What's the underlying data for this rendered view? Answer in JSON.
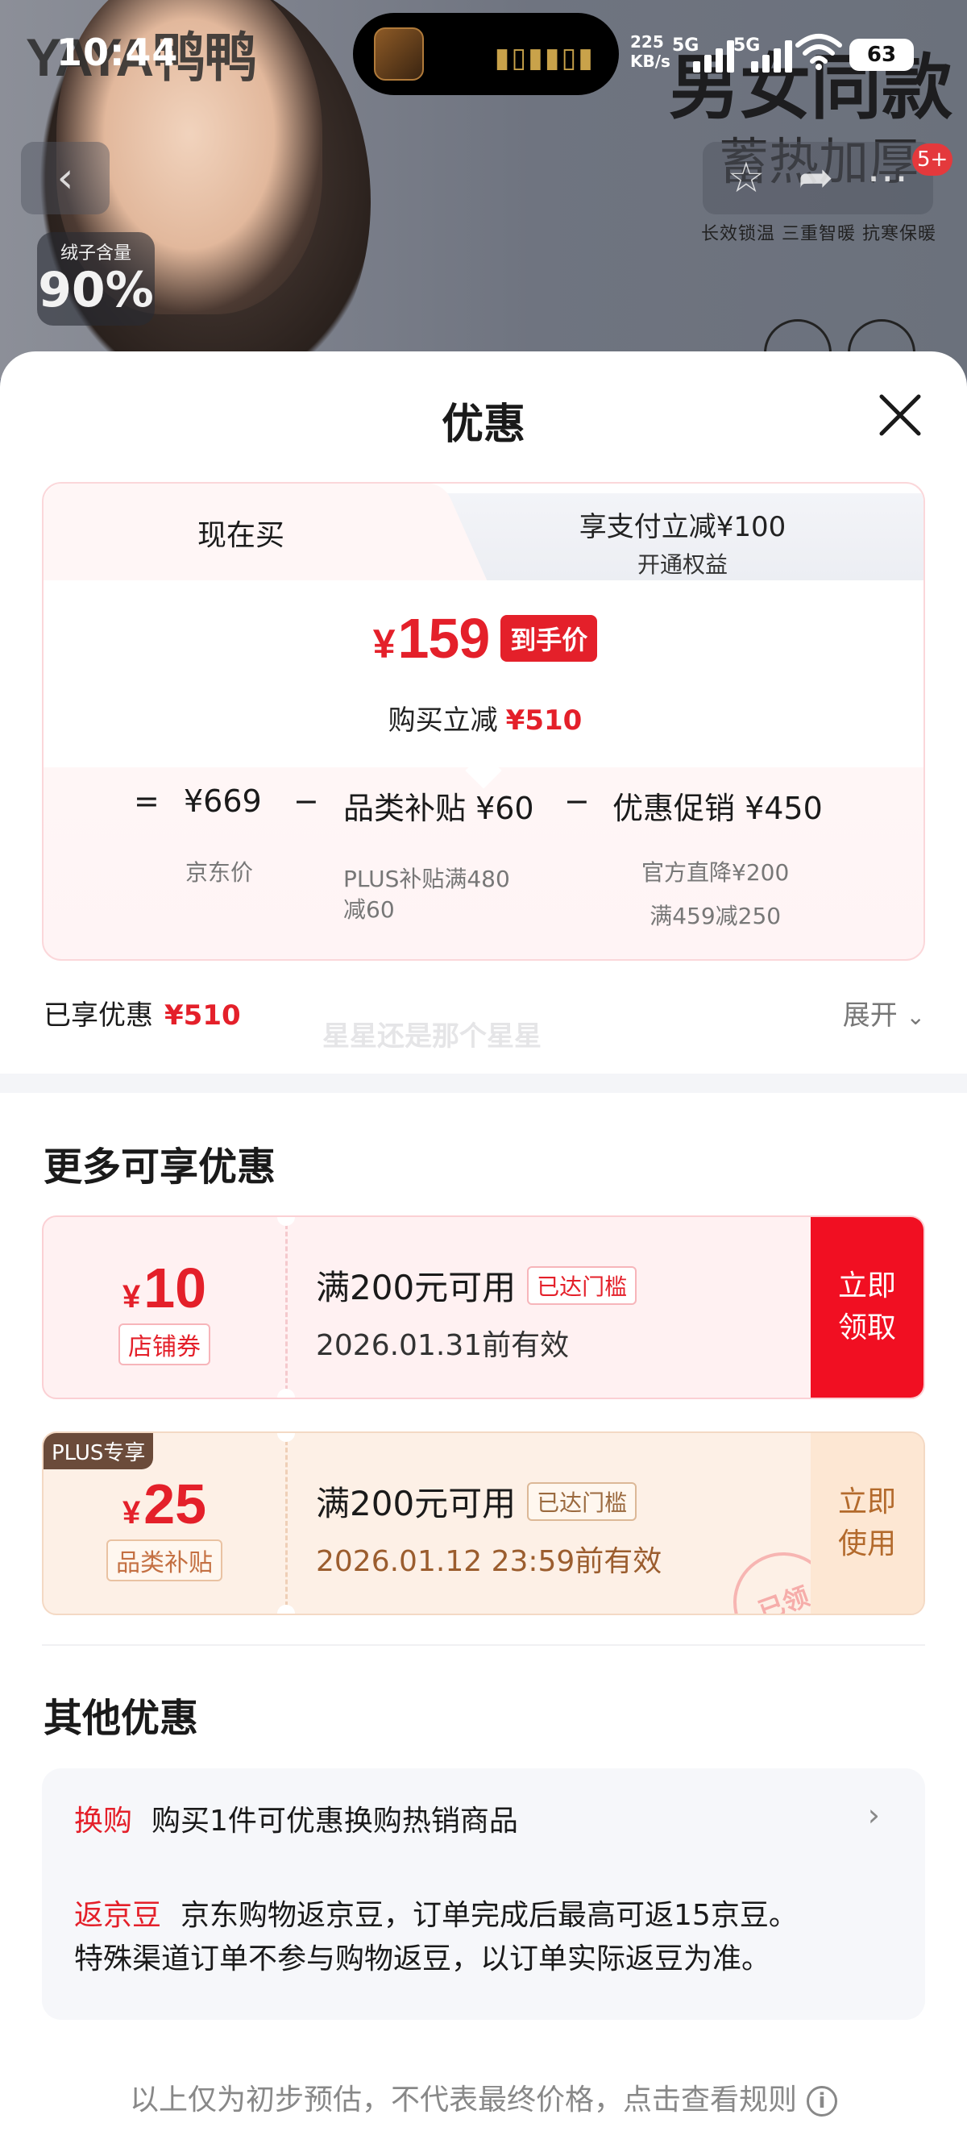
{
  "status_bar": {
    "time": "10:44",
    "net_speed_value": "225",
    "net_speed_unit": "KB/s",
    "sim1": "5G",
    "sim2": "5G",
    "battery": "63"
  },
  "banner": {
    "brand": "YAYA鸭鸭",
    "headline": "男女同款",
    "subline": "蓄热加厚",
    "features": "长效锁温 三重智暖 抗寒保暖",
    "down_badge_label": "绒子含量",
    "down_badge_value": "90%",
    "cart_count": "5+"
  },
  "sheet": {
    "title": "优惠",
    "tabs": {
      "now": "现在买",
      "pay_line1": "享支付立减¥100",
      "pay_line2": "开通权益"
    },
    "final_price": {
      "currency": "¥",
      "value": "159",
      "tag": "到手价",
      "reduce_label": "购买立减",
      "reduce_value": "¥510"
    },
    "calc": {
      "equals": "=",
      "jd_price": "¥669",
      "jd_price_label": "京东价",
      "minus1": "−",
      "category_subsidy": "品类补贴 ¥60",
      "category_subsidy_note_line1": "PLUS补贴满480",
      "category_subsidy_note_line2": "减60",
      "minus2": "−",
      "promo": "优惠促销 ¥450",
      "promo_note_line1": "官方直降¥200",
      "promo_note_line2": "满459减250"
    },
    "enjoyed_label": "已享优惠",
    "enjoyed_value": "¥510",
    "expand_label": "展开",
    "watermark": "星星还是那个星星",
    "more_title": "更多可享优惠",
    "coupons": [
      {
        "currency": "¥",
        "amount": "10",
        "type": "店铺券",
        "condition": "满200元可用",
        "reached": "已达门槛",
        "valid": "2026.01.31前有效",
        "action_line1": "立即",
        "action_line2": "领取"
      },
      {
        "plus_tag": "PLUS专享",
        "currency": "¥",
        "amount": "25",
        "type": "品类补贴",
        "condition": "满200元可用",
        "reached": "已达门槛",
        "valid": "2026.01.12 23:59前有效",
        "action_line1": "立即",
        "action_line2": "使用",
        "stamp": "已领"
      }
    ],
    "other_title": "其他优惠",
    "other": {
      "swap_tag": "换购",
      "swap_text": "购买1件可优惠换购热销商品",
      "bean_tag": "返京豆",
      "bean_text_line1": "京东购物返京豆，订单完成后最高可返15京豆。",
      "bean_text_line2": "特殊渠道订单不参与购物返豆，以订单实际返豆为准。"
    },
    "footnote": "以上仅为初步预估，不代表最终价格，点击查看规则"
  }
}
